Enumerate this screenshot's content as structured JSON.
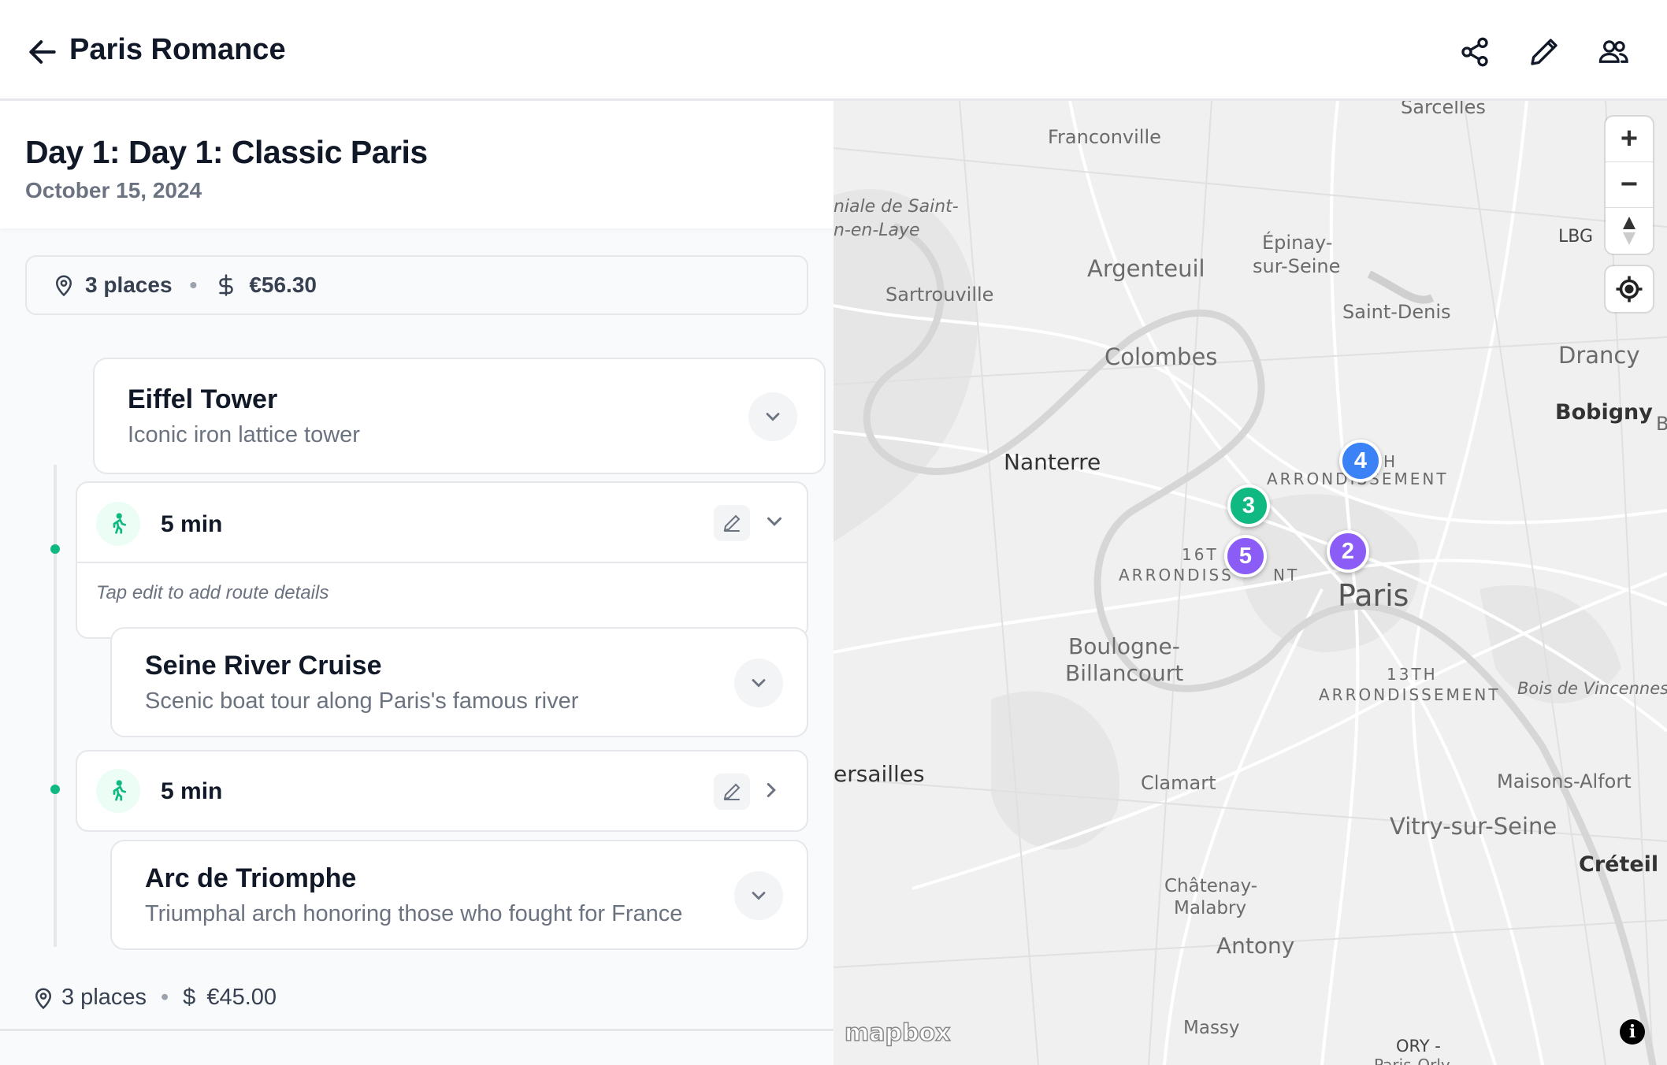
{
  "header": {
    "title": "Paris Romance",
    "back_icon": "arrow-left-icon",
    "actions": [
      "share-icon",
      "pencil-icon",
      "users-icon"
    ]
  },
  "day": {
    "title": "Day 1: Day 1: Classic Paris",
    "date": "October 15, 2024"
  },
  "summary": {
    "places": "3 places",
    "sep": "•",
    "cost": "€56.30"
  },
  "stops": [
    {
      "name": "Eiffel Tower",
      "description": "Iconic iron lattice tower"
    },
    {
      "name": "Seine River Cruise",
      "description": "Scenic boat tour along Paris's famous river"
    },
    {
      "name": "Arc de Triomphe",
      "description": "Triumphal arch honoring those who fought for France"
    }
  ],
  "routes": [
    {
      "duration": "5 min",
      "hint": "Tap edit to add route details",
      "mode_icon": "walking-icon"
    },
    {
      "duration": "5 min",
      "mode_icon": "walking-icon"
    }
  ],
  "footer": {
    "places": "3 places",
    "sep": "•",
    "dollar": "$",
    "cost": "€45.00"
  },
  "map": {
    "labels": {
      "sarcelles": "Sarcelles",
      "franconville": "Franconville",
      "saint_germain_1": "niale de Saint-",
      "saint_germain_2": "n-en-Laye",
      "epinay_1": "Épinay-",
      "epinay_2": "sur-Seine",
      "argenteuil": "Argenteuil",
      "sartrouville": "Sartrouville",
      "saint_denis": "Saint-Denis",
      "lbg": "LBG",
      "drancy": "Drancy",
      "colombes": "Colombes",
      "bobigny": "Bobigny",
      "b_edge": "B",
      "nanterre": "Nanterre",
      "arr_h": "H",
      "arrondissement_1": "ARRONDISSEMENT",
      "sixteenth_1": "16T",
      "arrondissement_2": "ARRONDISS",
      "arrondissement_2_end": "NT",
      "paris": "Paris",
      "boulogne_1": "Boulogne-",
      "boulogne_2": "Billancourt",
      "thirteenth_1": "13TH",
      "thirteenth_2": "ARRONDISSEMENT",
      "bois_vincennes": "Bois de Vincennes",
      "versailles": "ersailles",
      "clamart": "Clamart",
      "maisons_alfort": "Maisons-Alfort",
      "vitry": "Vitry-sur-Seine",
      "creteil": "Créteil",
      "chatenay_1": "Châtenay-",
      "chatenay_2": "Malabry",
      "antony": "Antony",
      "massy": "Massy",
      "ory": "ORY -",
      "ory_2": "Paris-Orly"
    },
    "markers": [
      {
        "label": "4",
        "color": "#3b82f6"
      },
      {
        "label": "3",
        "color": "#10b981"
      },
      {
        "label": "5",
        "color": "#8b5cf6"
      },
      {
        "label": "2",
        "color": "#8b5cf6"
      }
    ],
    "attribution": "mapbox",
    "info": "i",
    "controls": {
      "zoom_in": "+",
      "zoom_out": "−",
      "compass": "compass-icon",
      "locate": "locate-icon"
    }
  }
}
